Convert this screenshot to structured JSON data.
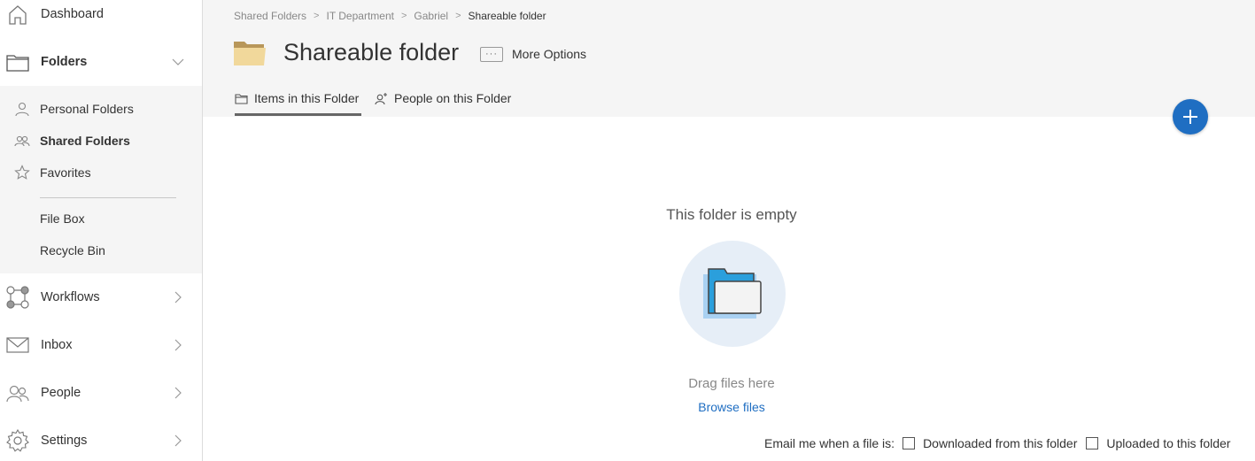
{
  "sidebar": {
    "dashboard": "Dashboard",
    "folders": "Folders",
    "sub_items": {
      "personal": "Personal Folders",
      "shared": "Shared Folders",
      "favorites": "Favorites",
      "file_box": "File Box",
      "recycle_bin": "Recycle Bin"
    },
    "workflows": "Workflows",
    "inbox": "Inbox",
    "people": "People",
    "settings": "Settings"
  },
  "breadcrumb": {
    "items": [
      "Shared Folders",
      "IT Department",
      "Gabriel",
      "Shareable folder"
    ]
  },
  "header": {
    "title": "Shareable folder",
    "more_options_icon": "···",
    "more_options": "More Options"
  },
  "tabs": {
    "items": "Items in this Folder",
    "people": "People on this Folder"
  },
  "main": {
    "empty_title": "This folder is empty",
    "drag_text": "Drag files here",
    "browse": "Browse files"
  },
  "notify": {
    "label": "Email me when a file is:",
    "downloaded": "Downloaded from this folder",
    "uploaded": "Uploaded to this folder"
  },
  "colors": {
    "accent": "#1f6ec2",
    "folder_tan": "#c8a96a",
    "folder_blue": "#2b9fdc",
    "circle_bg": "#e6eef7"
  },
  "icons": {
    "dashboard": "house-icon",
    "folders": "folder-icon",
    "workflows": "workflow-icon",
    "inbox": "envelope-icon",
    "people": "people-icon",
    "settings": "gear-icon",
    "add": "plus-icon"
  }
}
